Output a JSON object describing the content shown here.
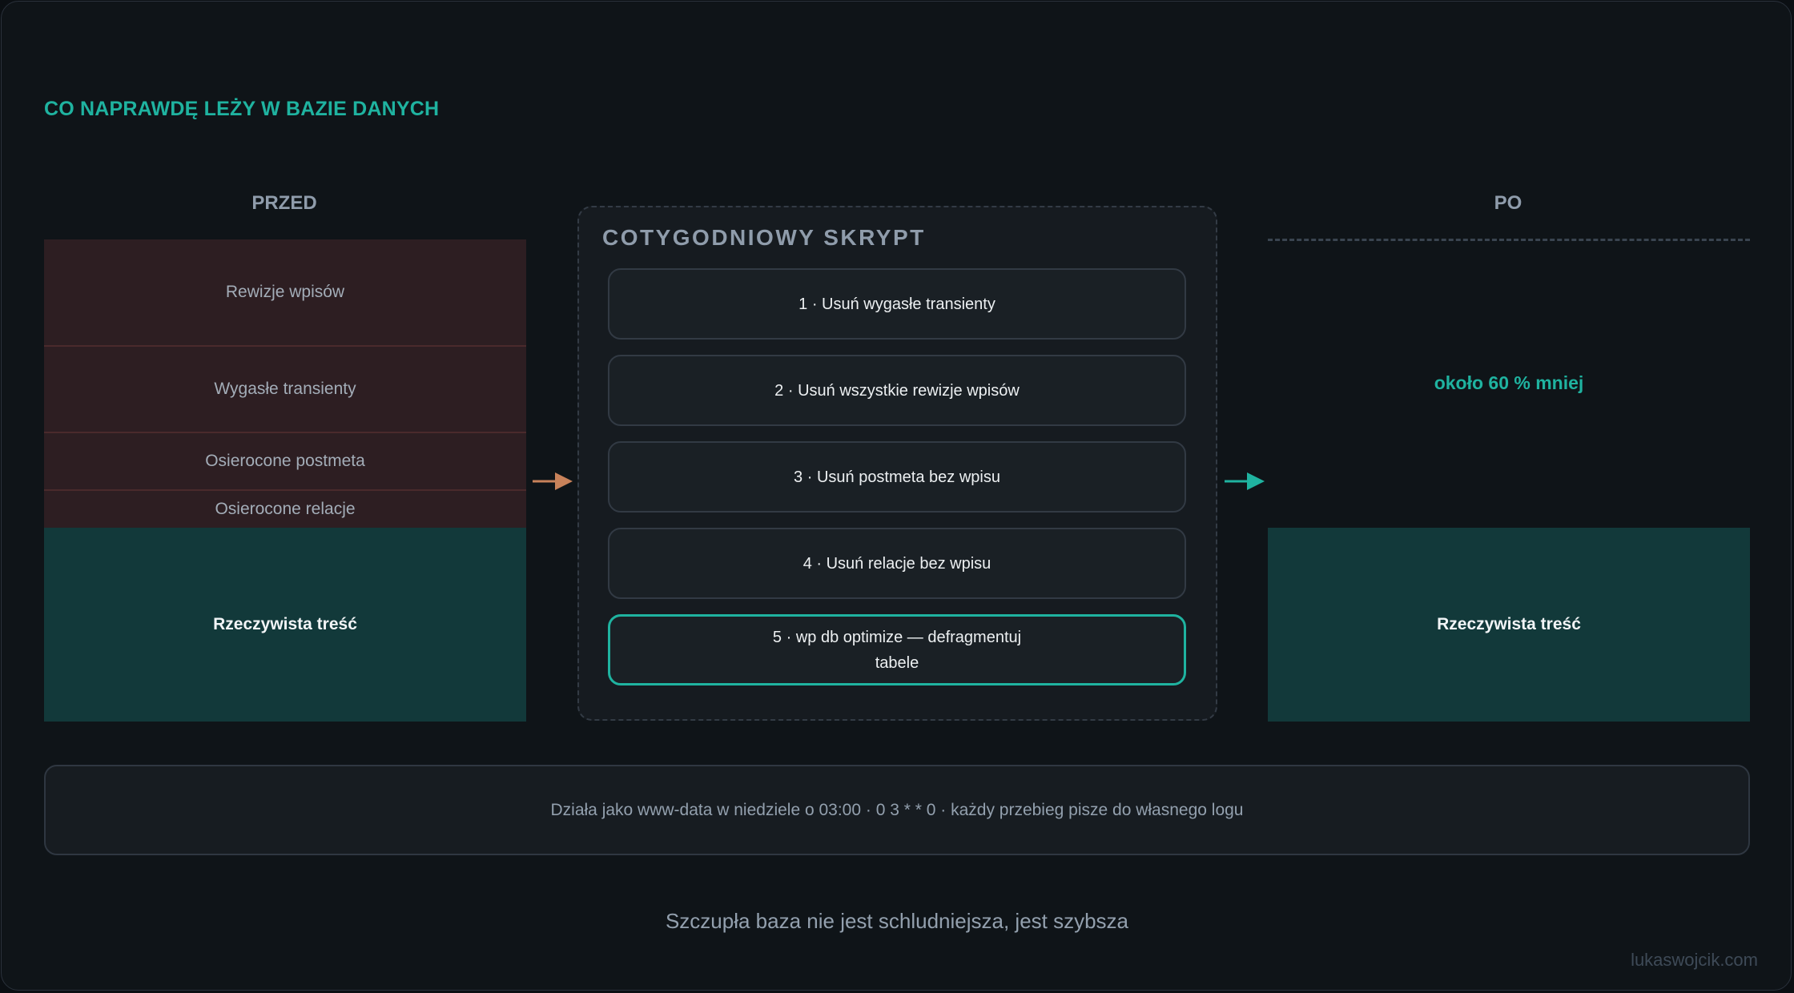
{
  "heading": "CO NAPRAWDĘ LEŻY W BAZIE DANYCH",
  "before": {
    "title": "PRZED",
    "segments": [
      {
        "label": "Rewizje wpisów"
      },
      {
        "label": "Wygasłe transienty"
      },
      {
        "label": "Osierocone postmeta"
      },
      {
        "label": "Osierocone relacje"
      },
      {
        "label": "Rzeczywista treść"
      }
    ]
  },
  "script": {
    "title": "COTYGODNIOWY SKRYPT",
    "steps": [
      {
        "label": "1 · Usuń wygasłe transienty"
      },
      {
        "label": "2 · Usuń wszystkie rewizje wpisów"
      },
      {
        "label": "3 · Usuń postmeta bez wpisu"
      },
      {
        "label": "4 · Usuń relacje bez wpisu"
      },
      {
        "label": "5 · wp db optimize — defragmentuj tabele"
      }
    ]
  },
  "after": {
    "title": "PO",
    "note": "około 60 % mniej",
    "real_content": "Rzeczywista treść"
  },
  "info": "Działa jako www-data w niedziele o 03:00 · 0 3 * * 0 · każdy przebieg pisze do własnego logu",
  "tagline": "Szczupła baza nie jest schludniejsza, jest szybsza",
  "credit": "lukaswojcik.com",
  "colors": {
    "accent": "#1fb3a0",
    "waste": "#2d1e22",
    "real": "#12393a",
    "arrow_in": "#c8825a",
    "arrow_out": "#1fb3a0"
  }
}
